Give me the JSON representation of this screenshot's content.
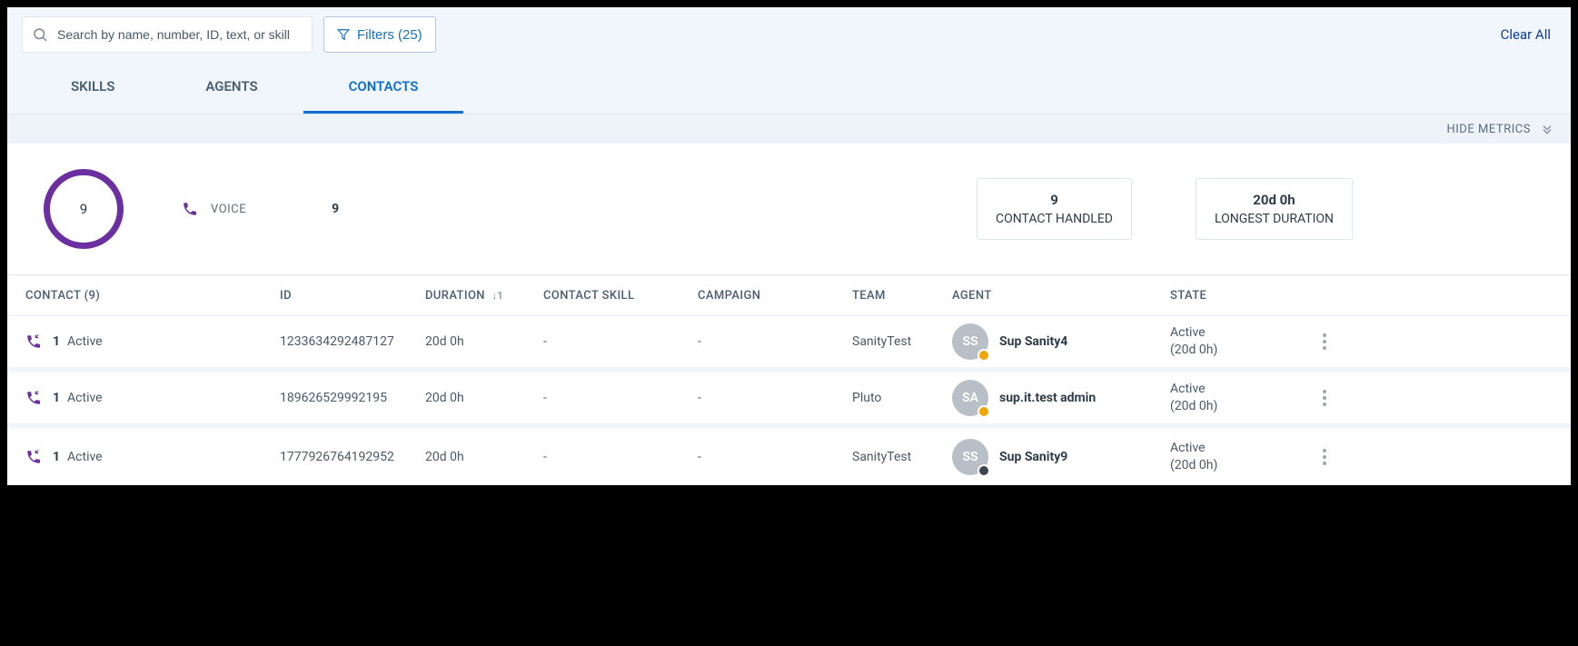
{
  "search": {
    "placeholder": "Search by name, number, ID, text, or skill"
  },
  "filters_button": "Filters (25)",
  "clear_all": "Clear All",
  "tabs": {
    "skills": "SKILLS",
    "agents": "AGENTS",
    "contacts": "CONTACTS"
  },
  "metrics_toggle": "HIDE METRICS",
  "ring_total": "9",
  "voice": {
    "label": "VOICE",
    "count": "9"
  },
  "cards": {
    "handled": {
      "value": "9",
      "label": "CONTACT HANDLED"
    },
    "longest": {
      "value": "20d 0h",
      "label": "LONGEST DURATION"
    }
  },
  "columns": {
    "contact": "CONTACT (9)",
    "id": "ID",
    "duration": "DURATION",
    "duration_sort": "↓1",
    "skill": "CONTACT SKILL",
    "campaign": "CAMPAIGN",
    "team": "TEAM",
    "agent": "AGENT",
    "state": "STATE"
  },
  "rows": [
    {
      "contact_count": "1",
      "contact_state": "Active",
      "id": "1233634292487127",
      "duration": "20d 0h",
      "skill": "-",
      "campaign": "-",
      "team": "SanityTest",
      "agent_initials": "SS",
      "agent_name": "Sup Sanity4",
      "agent_badge": "orange",
      "state": "Active",
      "state_detail": "(20d 0h)"
    },
    {
      "contact_count": "1",
      "contact_state": "Active",
      "id": "189626529992195",
      "duration": "20d 0h",
      "skill": "-",
      "campaign": "-",
      "team": "Pluto",
      "agent_initials": "SA",
      "agent_name": "sup.it.test admin",
      "agent_badge": "orange",
      "state": "Active",
      "state_detail": "(20d 0h)"
    },
    {
      "contact_count": "1",
      "contact_state": "Active",
      "id": "1777926764192952",
      "duration": "20d 0h",
      "skill": "-",
      "campaign": "-",
      "team": "SanityTest",
      "agent_initials": "SS",
      "agent_name": "Sup Sanity9",
      "agent_badge": "dark",
      "state": "Active",
      "state_detail": "(20d 0h)"
    }
  ]
}
